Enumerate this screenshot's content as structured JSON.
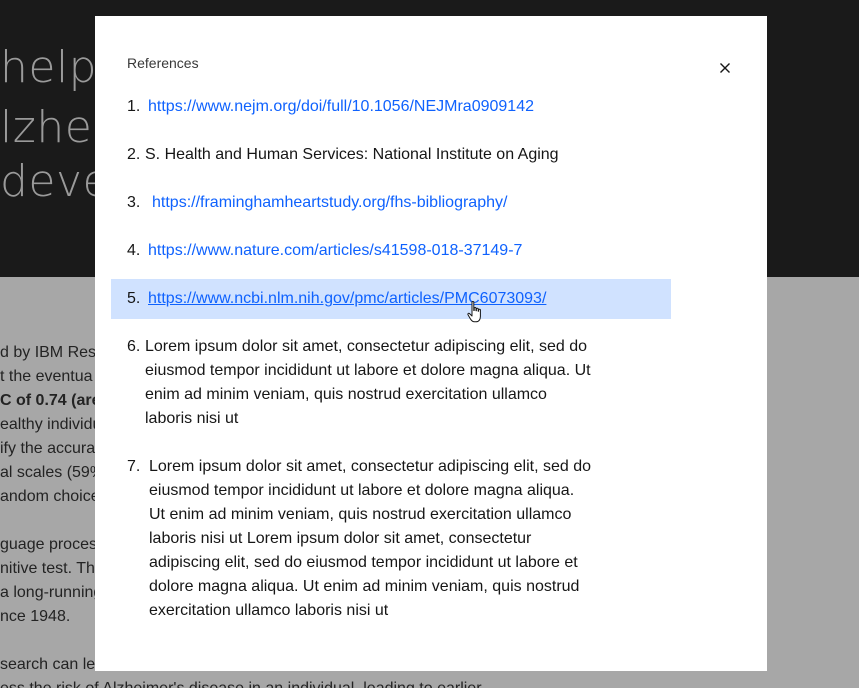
{
  "background": {
    "hero_lines": [
      "help",
      "lzhei",
      "deve"
    ],
    "body_lines": [
      {
        "text": "d by IBM Rese",
        "bold": false
      },
      {
        "text": "t the eventua",
        "bold": false
      },
      {
        "text": "C of 0.74 (are",
        "bold": true
      },
      {
        "text": "ealthy individu",
        "bold": false
      },
      {
        "text": "ify the accura",
        "bold": false
      },
      {
        "text": "al scales (59%",
        "bold": false
      },
      {
        "text": "andom choice",
        "bold": false
      },
      {
        "text": "guage proces",
        "bold": false
      },
      {
        "text": "nitive test. Th",
        "bold": false
      },
      {
        "text": "a long-running",
        "bold": false
      },
      {
        "text": "nce 1948.",
        "bold": false
      },
      {
        "text": "search can le",
        "bold": false
      },
      {
        "text": "ess the risk of Alzheimer's disease in an individual, leading to earlier",
        "bold": false
      }
    ]
  },
  "modal": {
    "title": "References",
    "close_icon": "close-icon",
    "references": [
      {
        "num": "1.",
        "text": "https://www.nejm.org/doi/full/10.1056/NEJMra0909142",
        "link": true
      },
      {
        "num": "2.",
        "text": "S. Health and Human Services: National Institute on Aging",
        "link": false
      },
      {
        "num": "3.",
        "text": "https://framinghamheartstudy.org/fhs-bibliography/",
        "link": true
      },
      {
        "num": "4.",
        "text": "https://www.nature.com/articles/s41598-018-37149-7",
        "link": true
      },
      {
        "num": "5.",
        "text": "https://www.ncbi.nlm.nih.gov/pmc/articles/PMC6073093/",
        "link": true,
        "hovered": true
      },
      {
        "num": "6.",
        "lines": [
          "Lorem ipsum dolor sit amet, consectetur adipiscing elit, sed do",
          "eiusmod tempor incididunt ut labore et dolore magna aliqua. Ut",
          "enim ad minim veniam, quis nostrud exercitation ullamco",
          "laboris nisi ut"
        ],
        "link": false
      },
      {
        "num": "7.",
        "lines": [
          "Lorem ipsum dolor sit amet, consectetur adipiscing elit, sed do",
          "eiusmod tempor incididunt ut labore et dolore magna aliqua.",
          "Ut enim ad minim veniam, quis nostrud exercitation ullamco",
          "laboris nisi ut Lorem ipsum dolor sit amet, consectetur",
          "adipiscing elit, sed do eiusmod tempor incididunt ut labore et",
          "dolore magna aliqua. Ut enim ad minim veniam, quis nostrud",
          "exercitation ullamco laboris nisi ut"
        ],
        "link": false
      }
    ]
  },
  "colors": {
    "link": "#0f62fe",
    "hover_background": "#d0e2ff",
    "hero_background": "#1a1a1a",
    "overlay_background": "#a7a7a7"
  }
}
